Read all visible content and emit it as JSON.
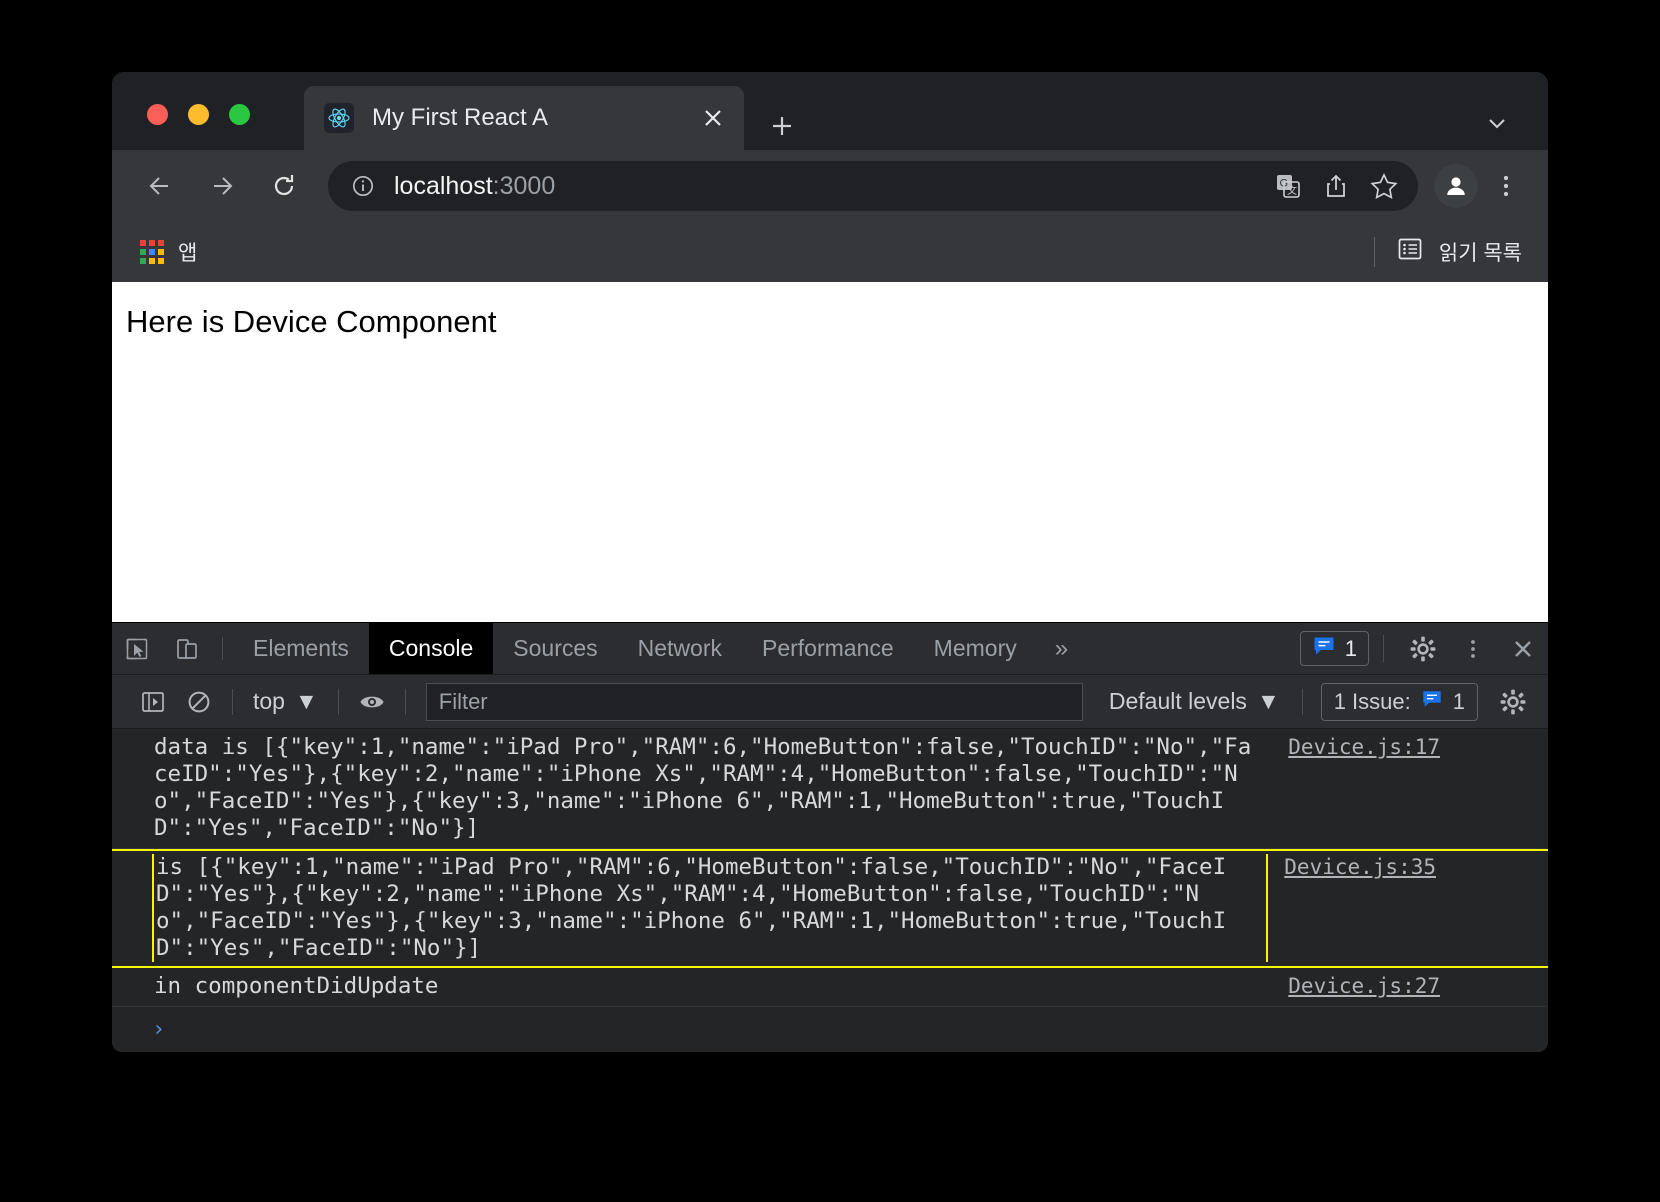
{
  "browser": {
    "tab": {
      "title": "My First React A",
      "favicon_icon": "react-logo-icon",
      "close_icon": "close-icon"
    },
    "newtab_label": "+",
    "tabstrip_chevron_icon": "chevron-down-icon",
    "toolbar": {
      "back_icon": "arrow-left-icon",
      "forward_icon": "arrow-right-icon",
      "reload_icon": "reload-icon",
      "site_info_icon": "info-circle-icon",
      "url_host": "localhost",
      "url_port": ":3000",
      "translate_icon": "translate-icon",
      "share_icon": "share-icon",
      "bookmark_icon": "star-icon",
      "profile_icon": "person-avatar-icon",
      "menu_icon": "three-dots-vertical-icon"
    },
    "bookmarks": {
      "apps_label": "앱",
      "apps_icon": "apps-grid-icon",
      "reading_list_label": "읽기 목록",
      "reading_list_icon": "reading-list-icon"
    }
  },
  "page": {
    "heading": "Here is Device Component"
  },
  "devtools": {
    "inspect_icon": "inspect-cursor-icon",
    "device_toolbar_icon": "device-toggle-icon",
    "tabs": [
      {
        "label": "Elements",
        "active": false
      },
      {
        "label": "Console",
        "active": true
      },
      {
        "label": "Sources",
        "active": false
      },
      {
        "label": "Network",
        "active": false
      },
      {
        "label": "Performance",
        "active": false
      },
      {
        "label": "Memory",
        "active": false
      }
    ],
    "more_tabs_label": "»",
    "issues_badge": {
      "icon": "issue-message-icon",
      "count": "1"
    },
    "settings_icon": "gear-icon",
    "dots_icon": "three-dots-vertical-icon",
    "close_icon": "close-icon",
    "filterbar": {
      "sidebar_icon": "console-sidebar-icon",
      "clear_icon": "clear-console-icon",
      "context_label": "top",
      "context_caret": "▼",
      "live_expression_icon": "eye-icon",
      "filter_placeholder": "Filter",
      "filter_value": "",
      "levels_label": "Default levels",
      "levels_caret": "▼",
      "issues_label": "1 Issue:",
      "issues_icon": "issue-message-icon",
      "issues_count": "1",
      "settings_icon": "gear-icon"
    },
    "console_messages": [
      {
        "text": "data is [{\"key\":1,\"name\":\"iPad Pro\",\"RAM\":6,\"HomeButton\":false,\"TouchID\":\"No\",\"FaceID\":\"Yes\"},{\"key\":2,\"name\":\"iPhone Xs\",\"RAM\":4,\"HomeButton\":false,\"TouchID\":\"No\",\"FaceID\":\"Yes\"},{\"key\":3,\"name\":\"iPhone 6\",\"RAM\":1,\"HomeButton\":true,\"TouchID\":\"Yes\",\"FaceID\":\"No\"}]",
        "source": "Device.js:17",
        "highlighted": false
      },
      {
        "text": "is [{\"key\":1,\"name\":\"iPad Pro\",\"RAM\":6,\"HomeButton\":false,\"TouchID\":\"No\",\"FaceID\":\"Yes\"},{\"key\":2,\"name\":\"iPhone Xs\",\"RAM\":4,\"HomeButton\":false,\"TouchID\":\"No\",\"FaceID\":\"Yes\"},{\"key\":3,\"name\":\"iPhone 6\",\"RAM\":1,\"HomeButton\":true,\"TouchID\":\"Yes\",\"FaceID\":\"No\"}]",
        "source": "Device.js:35",
        "highlighted": true
      },
      {
        "text": "in componentDidUpdate",
        "source": "Device.js:27",
        "highlighted": false
      }
    ],
    "prompt_glyph": "›"
  },
  "colors": {
    "highlight_border": "#f5f500",
    "accent_blue": "#1a73e8",
    "window_bg": "#292b2e",
    "devtools_bg": "#242527"
  }
}
